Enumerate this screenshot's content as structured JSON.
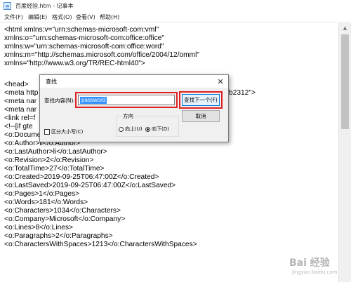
{
  "window": {
    "title": "百度经验.htm - 记事本"
  },
  "menu": [
    {
      "label": "文件(F)"
    },
    {
      "label": "编辑(E)"
    },
    {
      "label": "格式(O)"
    },
    {
      "label": "查看(V)"
    },
    {
      "label": "帮助(H)"
    }
  ],
  "editor": {
    "lines": [
      "<html xmlns:v=\"urn:schemas-microsoft-com:vml\"",
      "xmlns:o=\"urn:schemas-microsoft-com:office:office\"",
      "xmlns:w=\"urn:schemas-microsoft-com:office:word\"",
      "xmlns:m=\"http://schemas.microsoft.com/office/2004/12/omml\"",
      "xmlns=\"http://www.w3.org/TR/REC-html40\">",
      "",
      "<head>",
      "<meta http",
      "<meta nar",
      "<meta nar",
      "<link rel=f",
      "<!--[if gte",
      " <o:DocumentProperties>",
      "  <o:Author>li</o:Author>",
      "  <o:LastAuthor>li</o:LastAuthor>",
      "  <o:Revision>2</o:Revision>",
      "  <o:TotalTime>27</o:TotalTime>",
      "  <o:Created>2019-09-25T06:47:00Z</o:Created>",
      "  <o:LastSaved>2019-09-25T06:47:00Z</o:LastSaved>",
      "  <o:Pages>1</o:Pages>",
      "  <o:Words>181</o:Words>",
      "  <o:Characters>1034</o:Characters>",
      "  <o:Company>Microsoft</o:Company>",
      "  <o:Lines>8</o:Lines>",
      "  <o:Paragraphs>2</o:Paragraphs>",
      "  <o:CharactersWithSpaces>1213</o:CharactersWithSpaces>"
    ],
    "partial_right": "b2312\">"
  },
  "find_dialog": {
    "title": "查找",
    "find_label": "查找内容(N):",
    "find_value": "password",
    "find_next_label": "查找下一个(F)",
    "cancel_label": "取消",
    "direction_label": "方向",
    "direction_up": "向上(U)",
    "direction_down": "向下(D)",
    "direction_selected": "down",
    "match_case_label": "区分大小写(C)",
    "match_case_checked": false
  },
  "watermark": {
    "text": "Bai 经验",
    "sub": "jingyan.baidu.com"
  },
  "colors": {
    "highlight_red": "#e02020",
    "selection_blue": "#3390ff",
    "focus_blue": "#0078d7"
  }
}
